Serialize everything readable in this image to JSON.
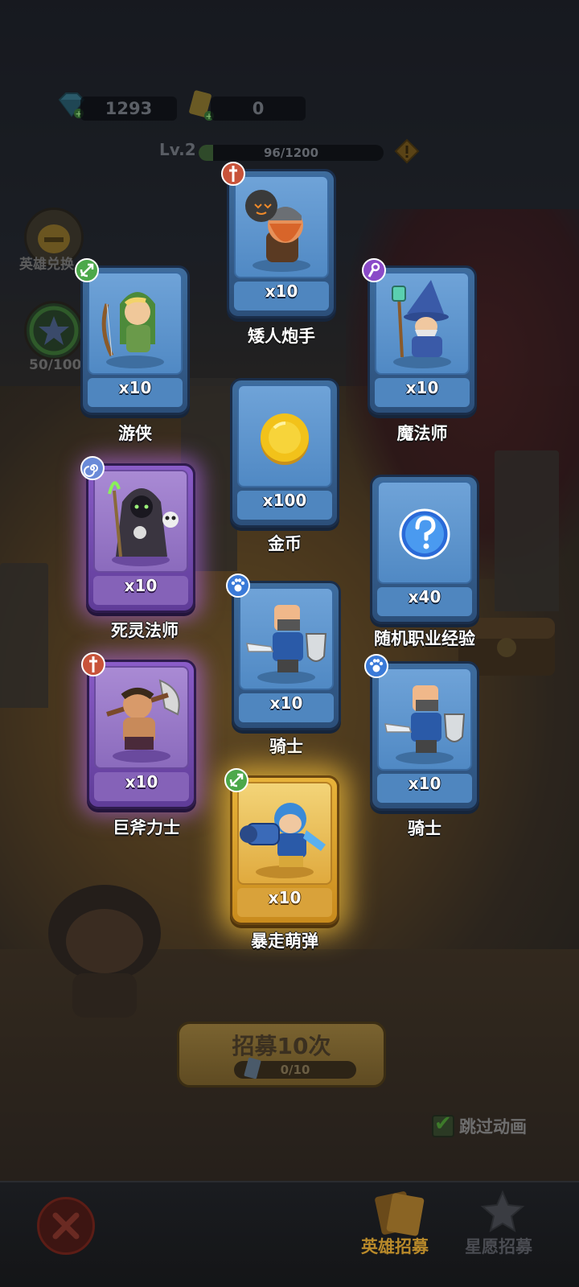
{
  "hud": {
    "gems": "1293",
    "tickets": "0",
    "level": "Lv.2",
    "xp_text": "96/1200",
    "xp_progress": 0.08
  },
  "side": {
    "hero_exchange": "英雄兑换",
    "star_progress": "50/100"
  },
  "cards": [
    {
      "name": "矮人炮手",
      "qty": "x10",
      "rarity": "blue",
      "class_icon": "sword-class-icon",
      "art": "dwarf-gunner"
    },
    {
      "name": "游侠",
      "qty": "x10",
      "rarity": "blue",
      "class_icon": "bow-class-icon",
      "art": "ranger"
    },
    {
      "name": "魔法师",
      "qty": "x10",
      "rarity": "blue",
      "class_icon": "magic-class-icon",
      "art": "wizard"
    },
    {
      "name": "金币",
      "qty": "x100",
      "rarity": "blue",
      "class_icon": "",
      "art": "gold-coin"
    },
    {
      "name": "死灵法师",
      "qty": "x10",
      "rarity": "purple",
      "class_icon": "spiral-class-icon",
      "art": "necromancer"
    },
    {
      "name": "随机职业经验",
      "qty": "x40",
      "rarity": "blue",
      "class_icon": "",
      "art": "question-orb"
    },
    {
      "name": "骑士",
      "qty": "x10",
      "rarity": "blue",
      "class_icon": "paw-class-icon",
      "art": "knight"
    },
    {
      "name": "巨斧力士",
      "qty": "x10",
      "rarity": "purple",
      "class_icon": "sword-class-icon",
      "art": "axe-warrior"
    },
    {
      "name": "骑士",
      "qty": "x10",
      "rarity": "blue",
      "class_icon": "paw-class-icon",
      "art": "knight"
    },
    {
      "name": "暴走萌弹",
      "qty": "x10",
      "rarity": "gold",
      "class_icon": "bow-class-icon",
      "art": "cannon-hero"
    }
  ],
  "recruit": {
    "label": "招募10次",
    "count": "0/10"
  },
  "skip": {
    "label": "跳过动画",
    "checked": true
  },
  "nav": {
    "hero_recruit": "英雄招募",
    "star_wish": "星愿招募"
  },
  "colors": {
    "card_blue": "#4f86bf",
    "card_purple": "#8562b8",
    "card_gold": "#e0aa3e",
    "nav_active": "#b98a2a"
  }
}
